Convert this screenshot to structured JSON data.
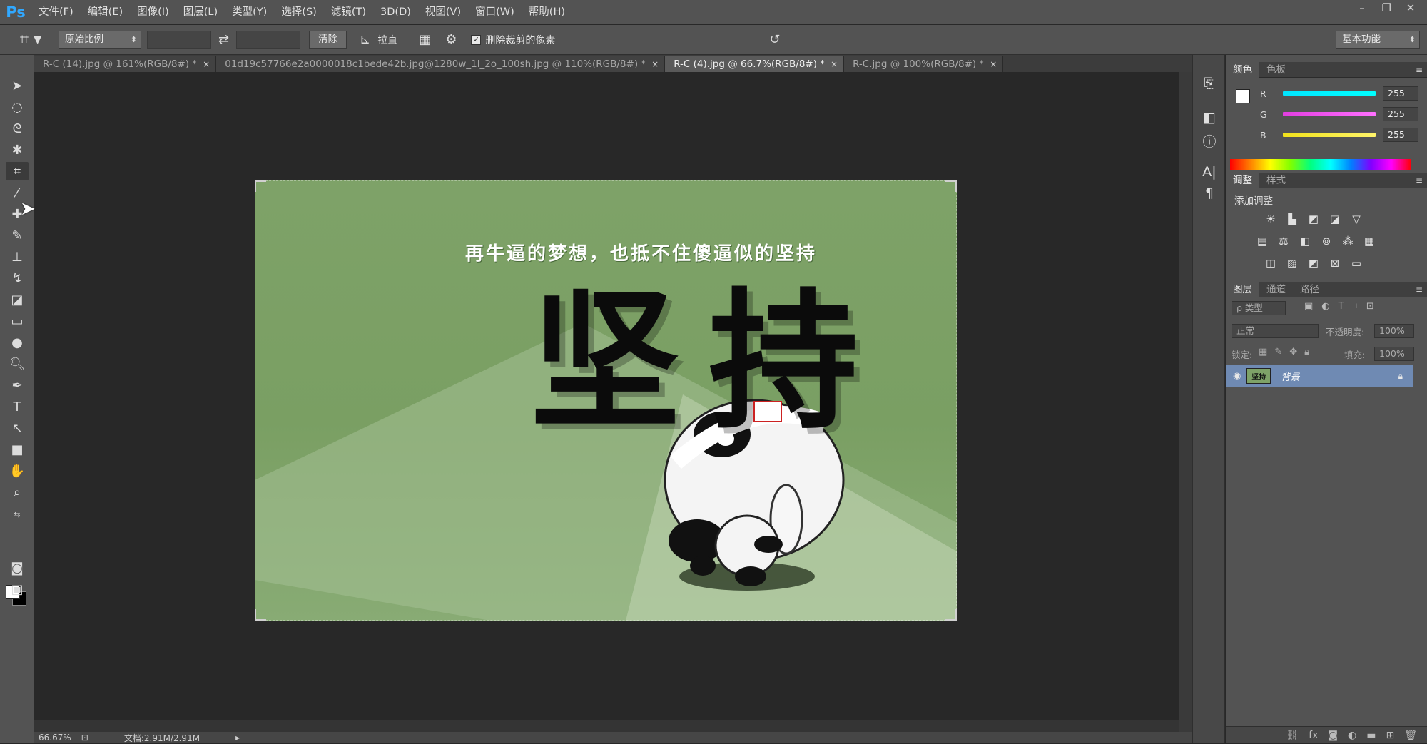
{
  "app": {
    "logo": "Ps"
  },
  "menu": [
    "文件(F)",
    "编辑(E)",
    "图像(I)",
    "图层(L)",
    "类型(Y)",
    "选择(S)",
    "滤镜(T)",
    "3D(D)",
    "视图(V)",
    "窗口(W)",
    "帮助(H)"
  ],
  "window_controls": {
    "minimize": "–",
    "restore": "❐",
    "close": "✕"
  },
  "options": {
    "ratio_select": "原始比例",
    "clear_button": "清除",
    "straighten_label": "拉直",
    "delete_pixels_label": "删除裁剪的像素",
    "delete_pixels_checked": "✓",
    "workspace": "基本功能"
  },
  "tabs": [
    {
      "label": "R-C (14).jpg @ 161%(RGB/8#) *",
      "close": "×"
    },
    {
      "label": "01d19c57766e2a0000018c1bede42b.jpg@1280w_1l_2o_100sh.jpg @ 110%(RGB/8#) *",
      "close": "×"
    },
    {
      "label": "R-C (4).jpg @ 66.7%(RGB/8#) *",
      "close": "×"
    },
    {
      "label": "R-C.jpg @ 100%(RGB/8#) *",
      "close": "×"
    }
  ],
  "image": {
    "tagline": "再牛逼的梦想，也抵不住傻逼似的坚持",
    "big_word": "坚持"
  },
  "status": {
    "zoom": "66.67%",
    "doc": "文档:2.91M/2.91M",
    "arrow": "▸"
  },
  "color_panel": {
    "tabs": [
      "颜色",
      "色板"
    ],
    "channels": [
      {
        "label": "R",
        "value": "255",
        "color": "#00e5ff"
      },
      {
        "label": "G",
        "value": "255",
        "color": "#e23ee0"
      },
      {
        "label": "B",
        "value": "255",
        "color": "#f1e21b"
      }
    ]
  },
  "adjust_panel": {
    "tabs": [
      "调整",
      "样式"
    ],
    "title": "添加调整"
  },
  "layers_panel": {
    "tabs": [
      "图层",
      "通道",
      "路径"
    ],
    "filter": "ρ 类型",
    "blend_mode": "正常",
    "opacity_label": "不透明度:",
    "opacity_value": "100%",
    "lock_label": "锁定:",
    "fill_label": "填充:",
    "fill_value": "100%",
    "layer_name": "背景",
    "layer_thumb_text": "坚持"
  },
  "colors": {
    "accent": "#31a8ff",
    "layer_selected": "#6f8ab3",
    "image_bg": "#7ea268"
  }
}
